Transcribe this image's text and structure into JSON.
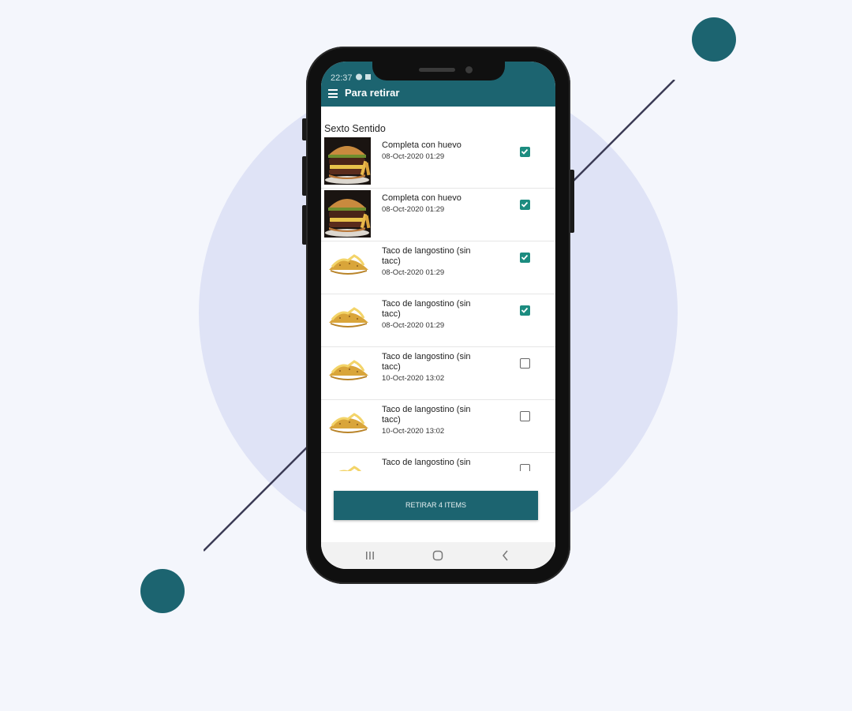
{
  "status_bar": {
    "time": "22:37",
    "icons": [
      "notification-a-icon",
      "notification-b-icon"
    ]
  },
  "app_bar": {
    "title": "Para retirar",
    "menu_icon": "hamburger-menu-icon"
  },
  "section": {
    "title": "Sexto Sentido"
  },
  "items": [
    {
      "name": "Completa con huevo",
      "date": "08-Oct-2020 01:29",
      "checked": true,
      "image": "burger"
    },
    {
      "name": "Completa con huevo",
      "date": "08-Oct-2020 01:29",
      "checked": true,
      "image": "burger"
    },
    {
      "name": "Taco de langostino (sin tacc)",
      "date": "08-Oct-2020 01:29",
      "checked": true,
      "image": "taco"
    },
    {
      "name": "Taco de langostino (sin tacc)",
      "date": "08-Oct-2020 01:29",
      "checked": true,
      "image": "taco"
    },
    {
      "name": "Taco de langostino (sin tacc)",
      "date": "10-Oct-2020 13:02",
      "checked": false,
      "image": "taco"
    },
    {
      "name": "Taco de langostino (sin tacc)",
      "date": "10-Oct-2020 13:02",
      "checked": false,
      "image": "taco"
    },
    {
      "name": "Taco de langostino (sin",
      "date": "",
      "checked": false,
      "image": "taco"
    }
  ],
  "action_button": {
    "label": "RETIRAR 4 ITEMS"
  },
  "nav_bar": {
    "icons": [
      "recents-icon",
      "home-icon",
      "back-icon"
    ]
  },
  "colors": {
    "primary": "#1c6470",
    "checkbox": "#1c8c80",
    "background": "#f4f6fc",
    "circle": "#dfe3f6"
  }
}
